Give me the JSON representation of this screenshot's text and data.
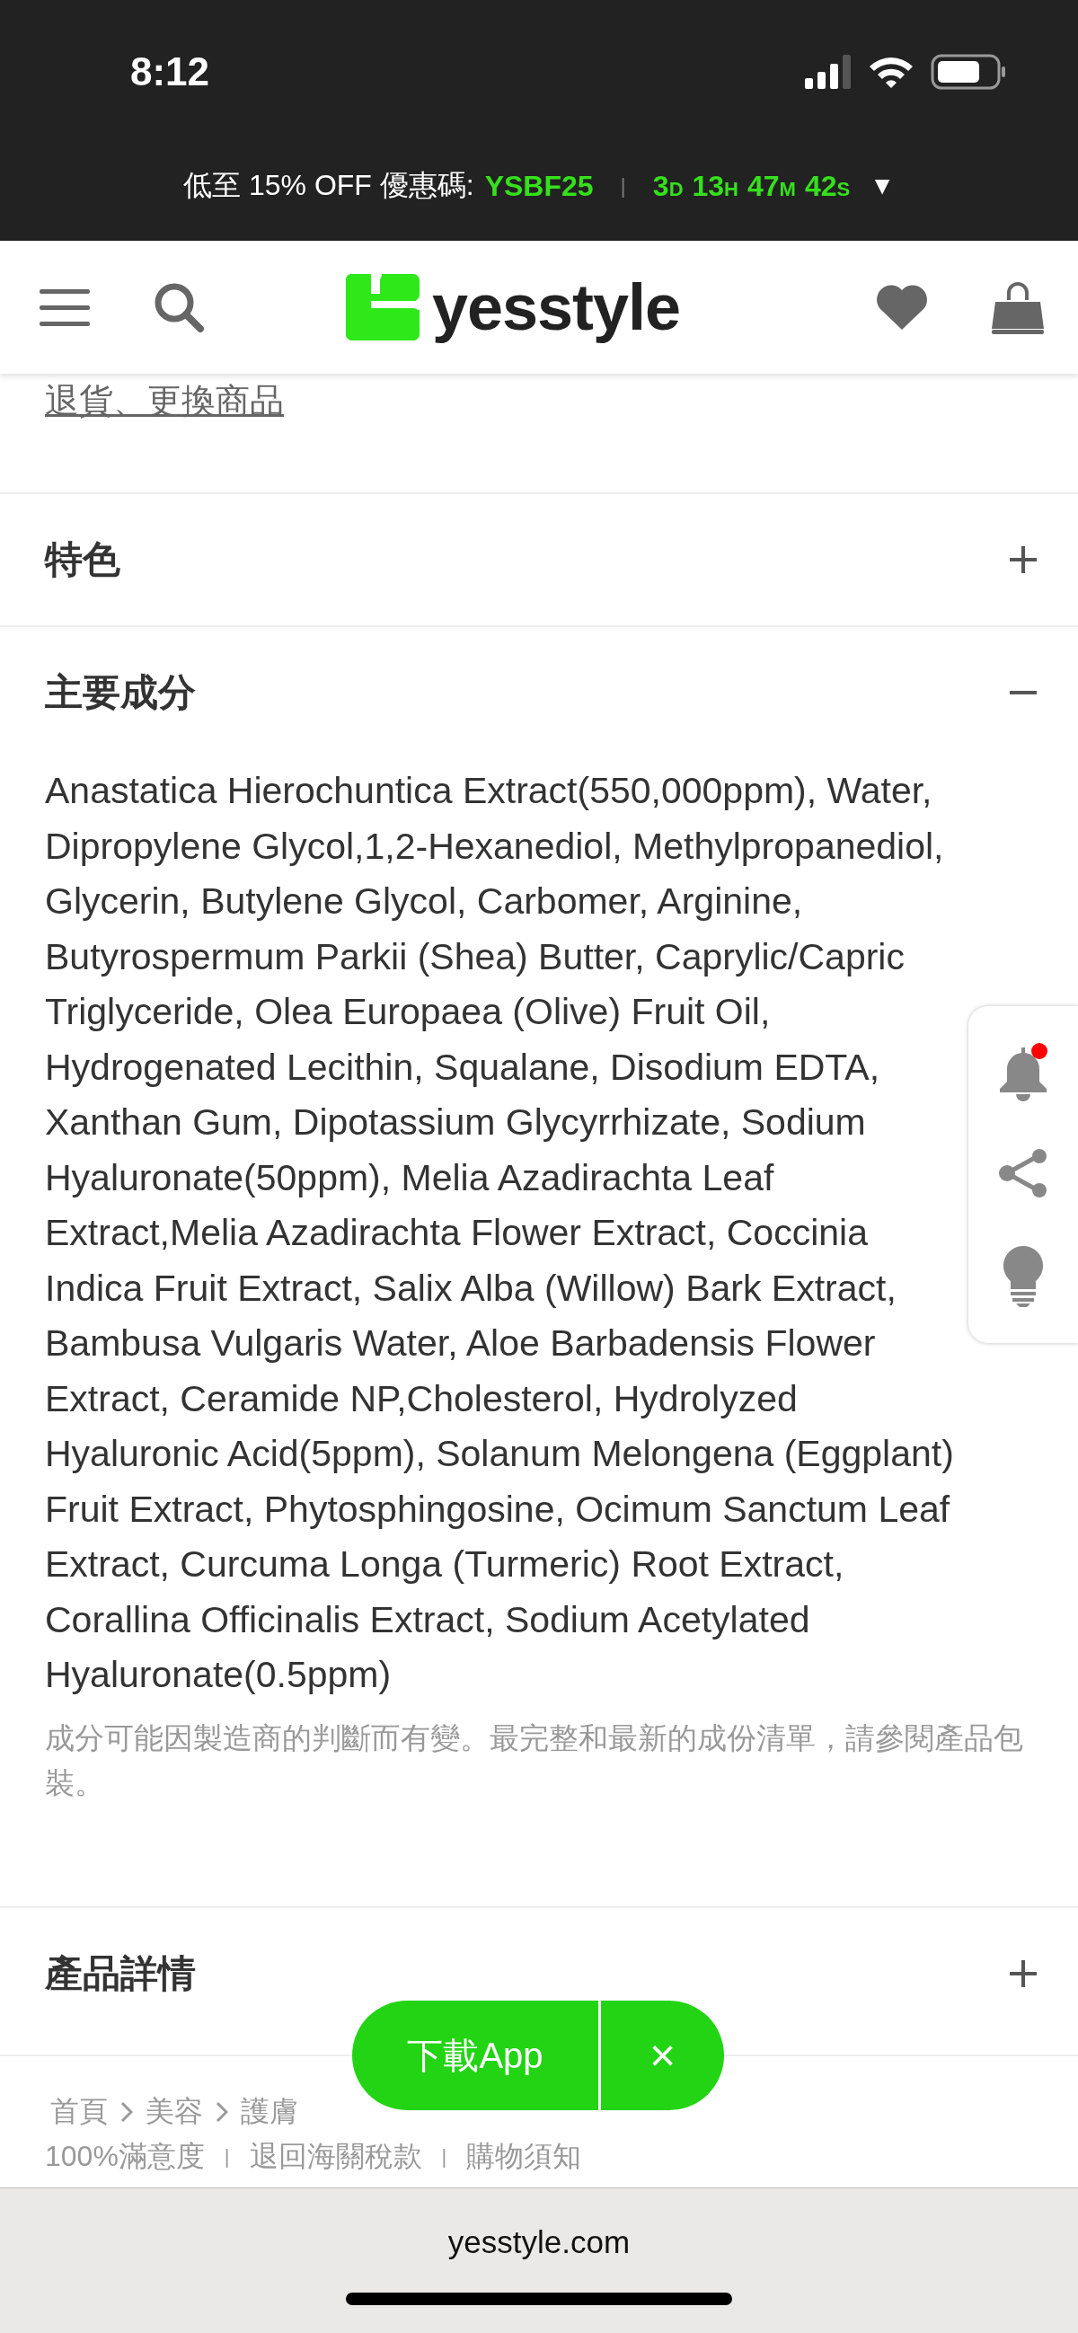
{
  "status_bar": {
    "time": "8:12"
  },
  "promo": {
    "text": "低至 15% OFF 優惠碼:",
    "code": "YSBF25",
    "separator": "|",
    "countdown": [
      {
        "value": "3",
        "unit": "D"
      },
      {
        "value": "13",
        "unit": "H"
      },
      {
        "value": "47",
        "unit": "M"
      },
      {
        "value": "42",
        "unit": "S"
      }
    ],
    "toggle": "▼"
  },
  "header": {
    "logo": "yesstyle"
  },
  "returns_link": "退貨、更換商品",
  "sections": [
    {
      "title": "特色",
      "expanded": false
    },
    {
      "title": "主要成分",
      "expanded": true,
      "body": "Anastatica Hierochuntica Extract(550,000ppm), Water, Dipropylene Glycol,1,2-Hexanediol, Methylpropanediol, Glycerin, Butylene Glycol, Carbomer, Arginine, Butyrospermum Parkii (Shea) Butter, Caprylic/Capric Triglyceride, Olea Europaea (Olive) Fruit Oil, Hydrogenated Lecithin, Squalane, Disodium EDTA, Xanthan Gum, Dipotassium Glycyrrhizate, Sodium Hyaluronate(50ppm), Melia Azadirachta Leaf Extract,Melia Azadirachta Flower Extract, Coccinia Indica Fruit Extract, Salix Alba (Willow) Bark Extract, Bambusa Vulgaris Water, Aloe Barbadensis Flower Extract, Ceramide NP,Cholesterol, Hydrolyzed Hyaluronic Acid(5ppm), Solanum Melongena (Eggplant) Fruit Extract, Phytosphingosine, Ocimum Sanctum Leaf Extract, Curcuma Longa (Turmeric) Root Extract, Corallina Officinalis Extract, Sodium Acetylated Hyaluronate(0.5ppm)",
      "note": "成分可能因製造商的判斷而有變。最完整和最新的成份清單，請參閱產品包裝。"
    },
    {
      "title": "產品詳情",
      "expanded": false
    }
  ],
  "breadcrumb": [
    "首頁",
    "美容",
    "護膚"
  ],
  "footer_links": [
    "100%滿意度",
    "退回海關稅款",
    "購物須知"
  ],
  "footer_separator": "|",
  "side_panel": {
    "notification_dot": true
  },
  "download_banner": {
    "label": "下載App",
    "close": "×"
  },
  "browser_bar": {
    "url": "yesstyle.com"
  }
}
